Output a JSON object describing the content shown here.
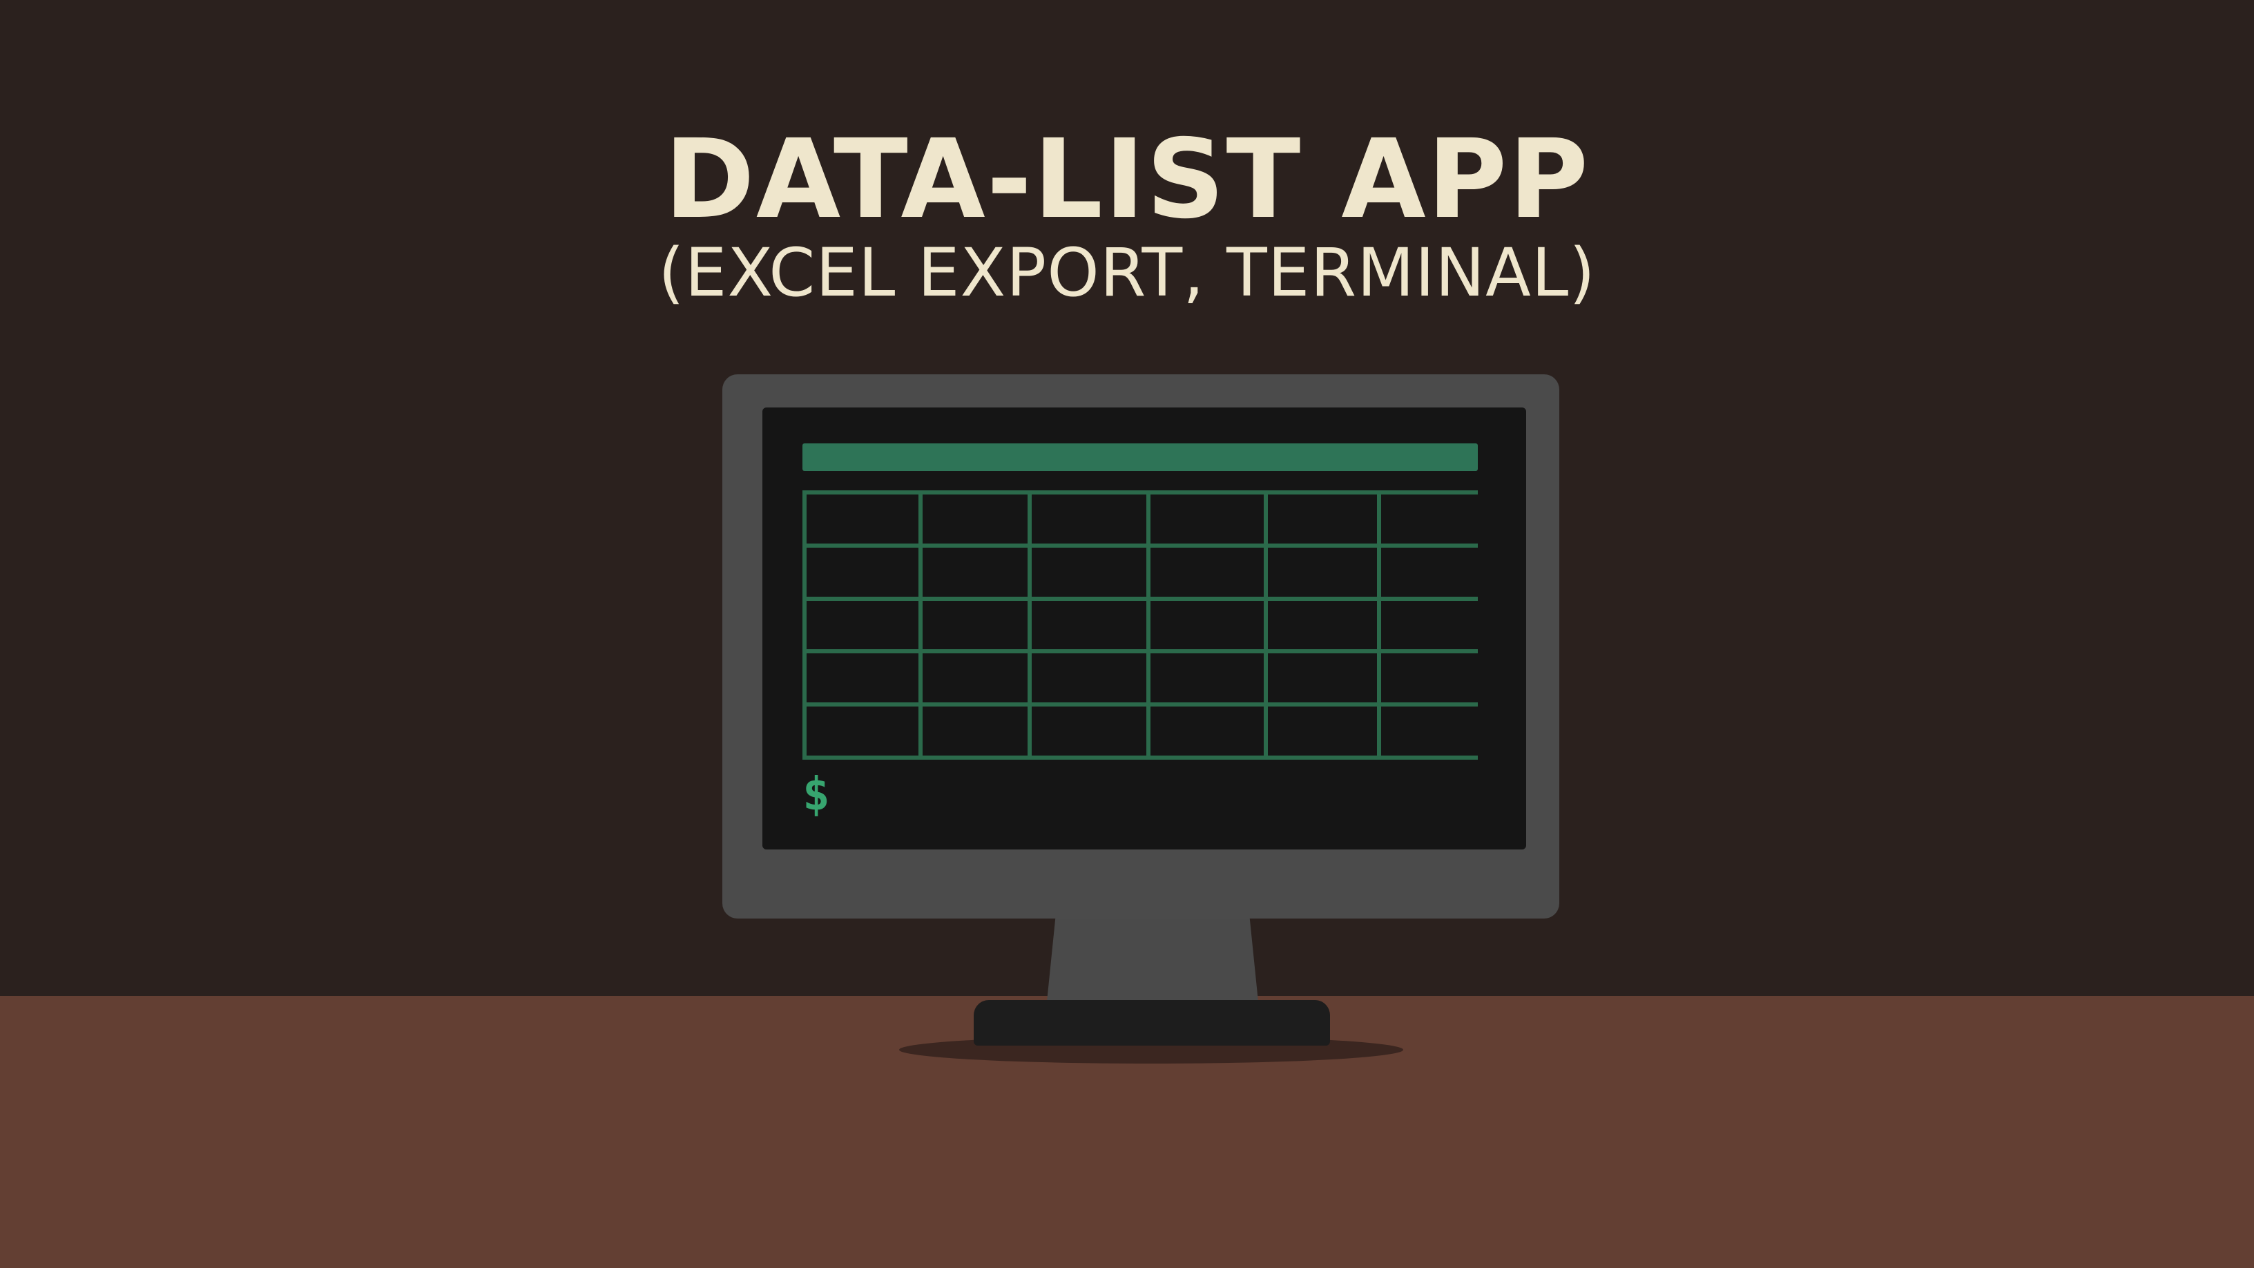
{
  "title": "DATA-LIST APP",
  "subtitle": "(EXCEL EXPORT, TERMINAL)",
  "screen": {
    "prompt_symbol": "$",
    "grid_columns": 6,
    "grid_rows": 5
  },
  "colors": {
    "background": "#2b211e",
    "desk": "#633f33",
    "title_text": "#efe6cc",
    "bezel": "#4b4b4b",
    "screen": "#151515",
    "accent_green": "#2e7457",
    "grid_lines": "#2b6a4b",
    "prompt": "#37a56f"
  }
}
